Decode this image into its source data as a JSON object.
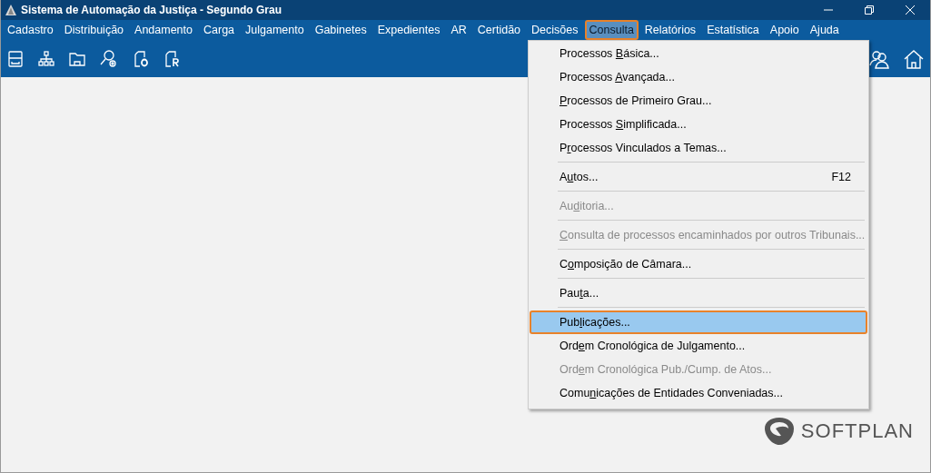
{
  "window": {
    "title": "Sistema de Automação da Justiça - Segundo Grau"
  },
  "menu_bar": [
    {
      "label": "Cadastro",
      "selected": false,
      "annotated": false
    },
    {
      "label": "Distribuição",
      "selected": false,
      "annotated": false
    },
    {
      "label": "Andamento",
      "selected": false,
      "annotated": false
    },
    {
      "label": "Carga",
      "selected": false,
      "annotated": false
    },
    {
      "label": "Julgamento",
      "selected": false,
      "annotated": false
    },
    {
      "label": "Gabinetes",
      "selected": false,
      "annotated": false
    },
    {
      "label": "Expedientes",
      "selected": false,
      "annotated": false
    },
    {
      "label": "AR",
      "selected": false,
      "annotated": false
    },
    {
      "label": "Certidão",
      "selected": false,
      "annotated": false
    },
    {
      "label": "Decisões",
      "selected": false,
      "annotated": false
    },
    {
      "label": "Consulta",
      "selected": true,
      "annotated": true
    },
    {
      "label": "Relatórios",
      "selected": false,
      "annotated": false
    },
    {
      "label": "Estatística",
      "selected": false,
      "annotated": false
    },
    {
      "label": "Apoio",
      "selected": false,
      "annotated": false
    },
    {
      "label": "Ajuda",
      "selected": false,
      "annotated": false
    }
  ],
  "dropdown": [
    {
      "kind": "item",
      "pre": "Processos ",
      "key": "B",
      "post": "ásica...",
      "disabled": false,
      "selected": false,
      "annotated": false
    },
    {
      "kind": "item",
      "pre": "Processos ",
      "key": "A",
      "post": "vançada...",
      "disabled": false,
      "selected": false,
      "annotated": false
    },
    {
      "kind": "item",
      "key": "P",
      "post": "rocessos de Primeiro Grau...",
      "disabled": false,
      "selected": false,
      "annotated": false
    },
    {
      "kind": "item",
      "pre": "Processos ",
      "key": "S",
      "post": "implificada...",
      "disabled": false,
      "selected": false,
      "annotated": false
    },
    {
      "kind": "item",
      "pre": "P",
      "key": "r",
      "post": "ocessos Vinculados a Temas...",
      "disabled": false,
      "selected": false,
      "annotated": false
    },
    {
      "kind": "separator"
    },
    {
      "kind": "item",
      "pre": "A",
      "key": "u",
      "post": "tos...",
      "shortcut": "F12",
      "disabled": false,
      "selected": false,
      "annotated": false
    },
    {
      "kind": "separator"
    },
    {
      "kind": "item",
      "pre": "Au",
      "key": "d",
      "post": "itoria...",
      "disabled": true,
      "selected": false,
      "annotated": false
    },
    {
      "kind": "separator"
    },
    {
      "kind": "item",
      "key": "C",
      "post": "onsulta de processos encaminhados por outros Tribunais...",
      "disabled": true,
      "selected": false,
      "annotated": false
    },
    {
      "kind": "separator"
    },
    {
      "kind": "item",
      "pre": "C",
      "key": "o",
      "post": "mposição de Câmara...",
      "disabled": false,
      "selected": false,
      "annotated": false
    },
    {
      "kind": "separator"
    },
    {
      "kind": "item",
      "pre": "Pau",
      "key": "t",
      "post": "a...",
      "disabled": false,
      "selected": false,
      "annotated": false
    },
    {
      "kind": "separator"
    },
    {
      "kind": "item",
      "pre": "Pub",
      "key": "l",
      "post": "icações...",
      "disabled": false,
      "selected": true,
      "annotated": true
    },
    {
      "kind": "item",
      "pre": "Ord",
      "key": "e",
      "post": "m Cronológica de Julgamento...",
      "disabled": false,
      "selected": false,
      "annotated": false
    },
    {
      "kind": "item",
      "pre": "Ord",
      "key": "e",
      "post": "m Cronológica Pub./Cump. de Atos...",
      "disabled": true,
      "selected": false,
      "annotated": false
    },
    {
      "kind": "item",
      "pre": "Comu",
      "key": "n",
      "post": "icações de Entidades Conveniadas...",
      "disabled": false,
      "selected": false,
      "annotated": false
    }
  ],
  "logo": {
    "text": "SOFTPLAN"
  }
}
